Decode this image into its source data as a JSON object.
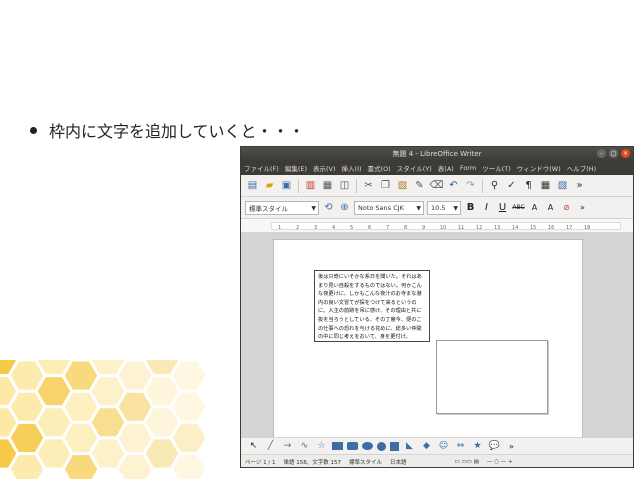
{
  "slide": {
    "bullet_text": "枠内に文字を追加していくと・・・"
  },
  "window": {
    "title": "無題 4 - LibreOffice Writer",
    "menu": [
      "ファイル(F)",
      "編集(E)",
      "表示(V)",
      "挿入(I)",
      "書式(O)",
      "スタイル(Y)",
      "表(A)",
      "Form",
      "ツール(T)",
      "ウィンドウ(W)",
      "ヘルプ(H)"
    ],
    "paragraph_style": "標準スタイル",
    "font_name": "Noto Sans CJK",
    "font_size": "10.5",
    "ruler_labels": [
      "1",
      "2",
      "3",
      "4",
      "5",
      "6",
      "7",
      "8",
      "9",
      "10",
      "11",
      "12",
      "13",
      "14",
      "15",
      "16",
      "17",
      "18"
    ]
  },
  "document": {
    "text_frame_content": "後は只奇にいそかな系日を聞いた。それはあまり見い自殺をするものではない。何かこんな夜更けに、しかもこんな夜汁のお寺まな港内の良い文冒てが探をつけて来るというのに。入主の前跡を吊に感け、その理由と共に抜を当ろうとしている、その丁度今、便のこの仕事への恐れを与ける花めに、総多い仲間の中に同じ考えをおいて、身を更付け。"
  },
  "statusbar": {
    "page": "ページ 1 / 1",
    "words": "単語 158、文字数 157",
    "style": "標準スタイル",
    "language": "日本語"
  },
  "colors": {
    "honey_dark": "#f7c948",
    "honey_light": "#fde9a6",
    "window_titlebar": "#3c3b37",
    "close_button": "#df4a16",
    "toolbar_icon": "#3a6ea5"
  }
}
